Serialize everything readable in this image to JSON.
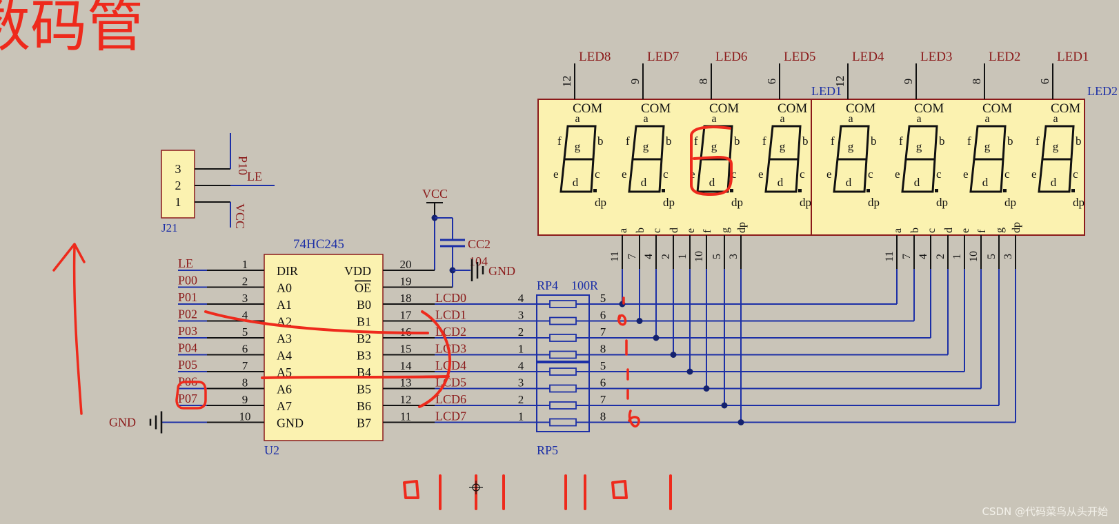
{
  "heading": "数码管",
  "watermark": "CSDN @代码菜鸟从头开始",
  "colors": {
    "background": "#c9c4b8",
    "component_fill": "#fbf2b0",
    "component_border": "#8b1a1a",
    "net_label": "#8b1a1a",
    "wire_blue": "#1c2fa6",
    "wire_black": "#111111",
    "annotation_red": "#ee2a1c"
  },
  "j21": {
    "ref": "J21",
    "pins": [
      "3",
      "2",
      "1"
    ],
    "nets": [
      "P10",
      "LE",
      "VCC"
    ]
  },
  "u2": {
    "ref": "U2",
    "part": "74HC245",
    "left_pins": [
      {
        "num": "1",
        "name": "DIR",
        "net": "LE"
      },
      {
        "num": "2",
        "name": "A0",
        "net": "P00"
      },
      {
        "num": "3",
        "name": "A1",
        "net": "P01"
      },
      {
        "num": "4",
        "name": "A2",
        "net": "P02"
      },
      {
        "num": "5",
        "name": "A3",
        "net": "P03"
      },
      {
        "num": "6",
        "name": "A4",
        "net": "P04"
      },
      {
        "num": "7",
        "name": "A5",
        "net": "P05"
      },
      {
        "num": "8",
        "name": "A6",
        "net": "P06"
      },
      {
        "num": "9",
        "name": "A7",
        "net": "P07"
      },
      {
        "num": "10",
        "name": "GND",
        "net": "GND"
      }
    ],
    "right_pins": [
      {
        "num": "20",
        "name": "VDD",
        "net": ""
      },
      {
        "num": "19",
        "name": "OE",
        "net": ""
      },
      {
        "num": "18",
        "name": "B0",
        "net": "LCD0"
      },
      {
        "num": "17",
        "name": "B1",
        "net": "LCD1"
      },
      {
        "num": "16",
        "name": "B2",
        "net": "LCD2"
      },
      {
        "num": "15",
        "name": "B3",
        "net": "LCD3"
      },
      {
        "num": "14",
        "name": "B4",
        "net": "LCD4"
      },
      {
        "num": "13",
        "name": "B5",
        "net": "LCD5"
      },
      {
        "num": "12",
        "name": "B6",
        "net": "LCD6"
      },
      {
        "num": "11",
        "name": "B7",
        "net": "LCD7"
      }
    ]
  },
  "power": {
    "vcc": "VCC",
    "gnd": "GND",
    "gnd_u2": "GND",
    "cap_ref": "CC2",
    "cap_value": "104"
  },
  "resistors": {
    "top_ref": "RP4",
    "value": "100R",
    "bottom_ref": "RP5",
    "left_pins": [
      "4",
      "3",
      "2",
      "1",
      "4",
      "3",
      "2",
      "1"
    ],
    "right_pins": [
      "5",
      "6",
      "7",
      "8",
      "5",
      "6",
      "7",
      "8"
    ]
  },
  "display": {
    "top_labels": [
      "LED8",
      "LED7",
      "LED6",
      "LED5",
      "LED4",
      "LED3",
      "LED2",
      "LED1"
    ],
    "top_pins": [
      "12",
      "9",
      "8",
      "6",
      "12",
      "9",
      "8",
      "6"
    ],
    "side_labels": [
      "LED1",
      "LED2"
    ],
    "digit_texts": {
      "com": "COM",
      "a": "a",
      "b": "b",
      "c": "c",
      "d": "d",
      "e": "e",
      "f": "f",
      "g": "g",
      "dp": "dp"
    },
    "segment_pin_labels": [
      "a",
      "b",
      "c",
      "d",
      "e",
      "f",
      "g",
      "dp"
    ],
    "segment_pin_numbers": [
      "11",
      "7",
      "4",
      "2",
      "1",
      "10",
      "5",
      "3"
    ]
  },
  "annotations": {
    "binary_groups": [
      "0111",
      "1101"
    ],
    "digit_highlight": "6"
  }
}
